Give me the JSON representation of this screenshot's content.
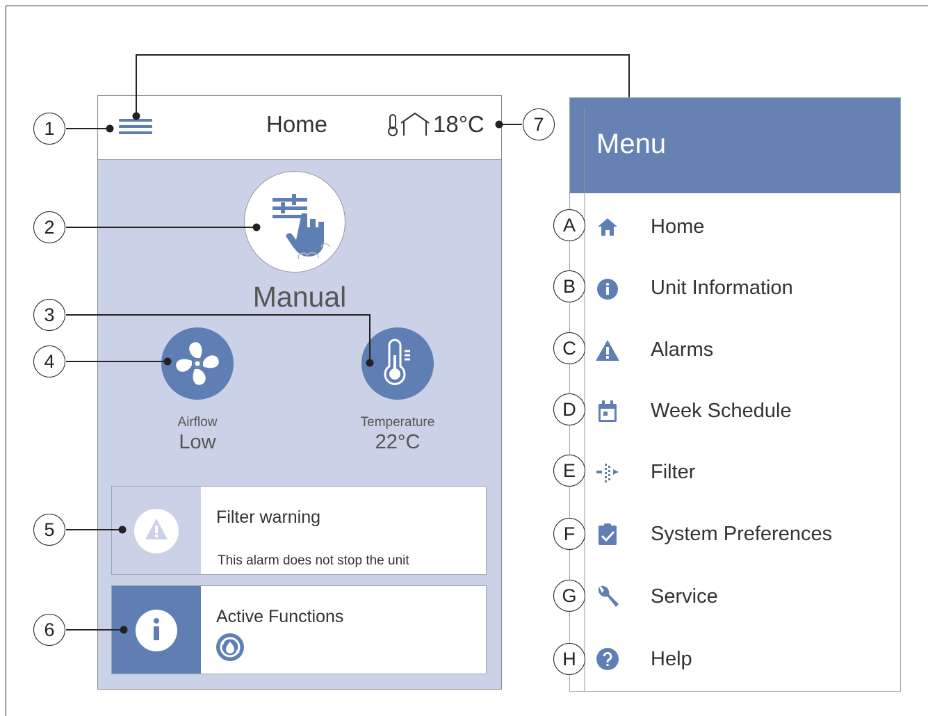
{
  "screen": {
    "header": {
      "title": "Home",
      "temperature": "18°C"
    },
    "mode": {
      "label": "Manual"
    },
    "airflow": {
      "caption": "Airflow",
      "value": "Low"
    },
    "temperature": {
      "caption": "Temperature",
      "value": "22°C"
    },
    "alarm_card": {
      "title": "Filter warning",
      "subtitle": "This alarm does not stop the unit"
    },
    "functions_card": {
      "title": "Active Functions"
    }
  },
  "menu": {
    "title": "Menu",
    "items": [
      {
        "letter": "A",
        "label": "Home",
        "icon": "home-icon"
      },
      {
        "letter": "B",
        "label": "Unit Information",
        "icon": "info-icon"
      },
      {
        "letter": "C",
        "label": "Alarms",
        "icon": "warning-icon"
      },
      {
        "letter": "D",
        "label": "Week Schedule",
        "icon": "calendar-icon"
      },
      {
        "letter": "E",
        "label": "Filter",
        "icon": "filter-icon"
      },
      {
        "letter": "F",
        "label": "System Preferences",
        "icon": "clipboard-check-icon"
      },
      {
        "letter": "G",
        "label": "Service",
        "icon": "wrench-icon"
      },
      {
        "letter": "H",
        "label": "Help",
        "icon": "help-icon"
      }
    ]
  },
  "callouts": [
    "1",
    "2",
    "3",
    "4",
    "5",
    "6",
    "7"
  ],
  "colors": {
    "accent": "#5f7fb4",
    "screen_bg": "#cbd1e6",
    "menu_header": "#6582b3"
  }
}
